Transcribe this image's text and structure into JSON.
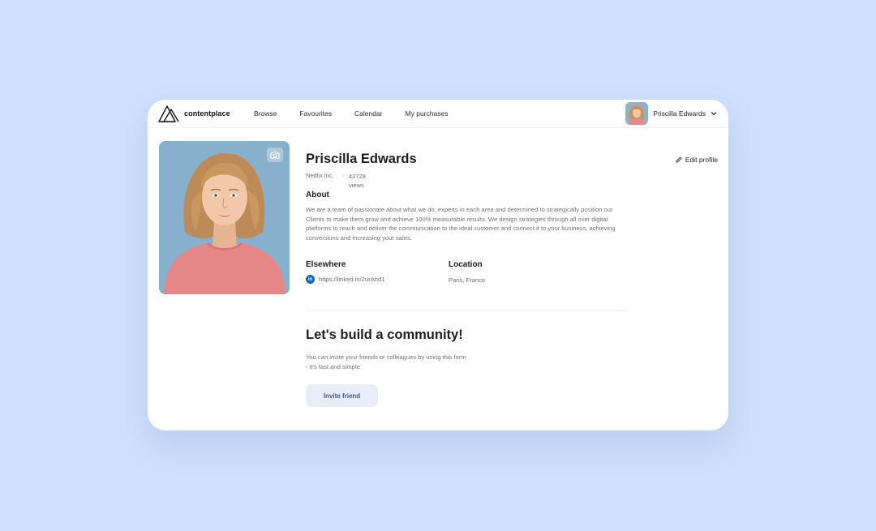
{
  "brand": {
    "name": "contentplace",
    "logo_icon": "mountain-triangle-icon"
  },
  "nav": {
    "items": [
      {
        "label": "Browse"
      },
      {
        "label": "Favourites"
      },
      {
        "label": "Calendar"
      },
      {
        "label": "My purchases"
      }
    ]
  },
  "user_menu": {
    "name": "Priscilla Edwards",
    "icon": "chevron-down-icon"
  },
  "profile": {
    "name": "Priscilla Edwards",
    "edit_label": "Edit profile",
    "company": "Netflix inc.",
    "separator": "·",
    "views": "42729 views",
    "about_heading": "About",
    "about_text": "We are a team of passionate about what we do, experts in each area and determined to strategically position our Clients to make them grow and achieve 100% measurable results. We design strategies through all over digital platforms to reach and deliver the communication to the ideal customer and connect it to your business, achieving conversions and increasing your sales.",
    "elsewhere_heading": "Elsewhere",
    "linkedin_url": "https://linked.in/2urAhd1",
    "location_heading": "Location",
    "location": "Paris, France"
  },
  "community": {
    "heading": "Let's build a community!",
    "text": "You can invite your friends or colleagues by using this form - it's fast and simple",
    "button_label": "Invite friend"
  },
  "colors": {
    "background": "#cfe0fc",
    "card": "#ffffff",
    "button_bg": "#e9edf8",
    "button_text": "#3d5a9e",
    "linkedin": "#0a66c2"
  }
}
